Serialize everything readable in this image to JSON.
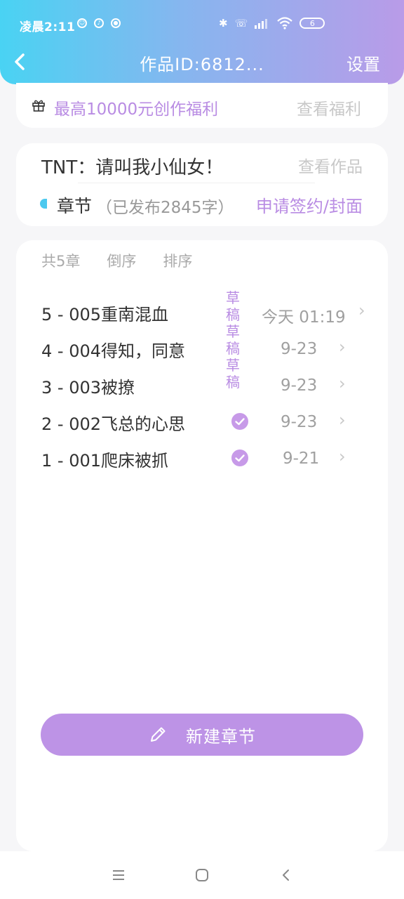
{
  "status": {
    "time": "凌晨2:11",
    "battery": "6"
  },
  "nav": {
    "title": "作品ID:6812...",
    "setting": "设置"
  },
  "welfare": {
    "text": "最高10000元创作福利",
    "link": "查看福利"
  },
  "work": {
    "title": "TNT：请叫我小仙女！",
    "view_link": "查看作品",
    "chapter_label": "章节",
    "chapter_count": "（已发布2845字）",
    "sign_link": "申请签约/封面"
  },
  "list_tools": {
    "count": "共5章",
    "reverse": "倒序",
    "sort": "排序"
  },
  "draft_labels": [
    "草",
    "稿",
    "草",
    "稿",
    "草",
    "稿"
  ],
  "chapters": [
    {
      "title": "5 - 005重南混血",
      "date": "今天 01:19",
      "published": false
    },
    {
      "title": "4 - 004得知，同意",
      "date": "9-23",
      "published": false
    },
    {
      "title": "3 - 003被撩",
      "date": "9-23",
      "published": false
    },
    {
      "title": "2 - 002飞总的心思",
      "date": "9-23",
      "published": true
    },
    {
      "title": "1 - 001爬床被抓",
      "date": "9-21",
      "published": true
    }
  ],
  "new_chapter": "新建章节",
  "colors": {
    "accent": "#b98ce3",
    "button": "#bd93e6",
    "cyan": "#4cc9ef"
  }
}
